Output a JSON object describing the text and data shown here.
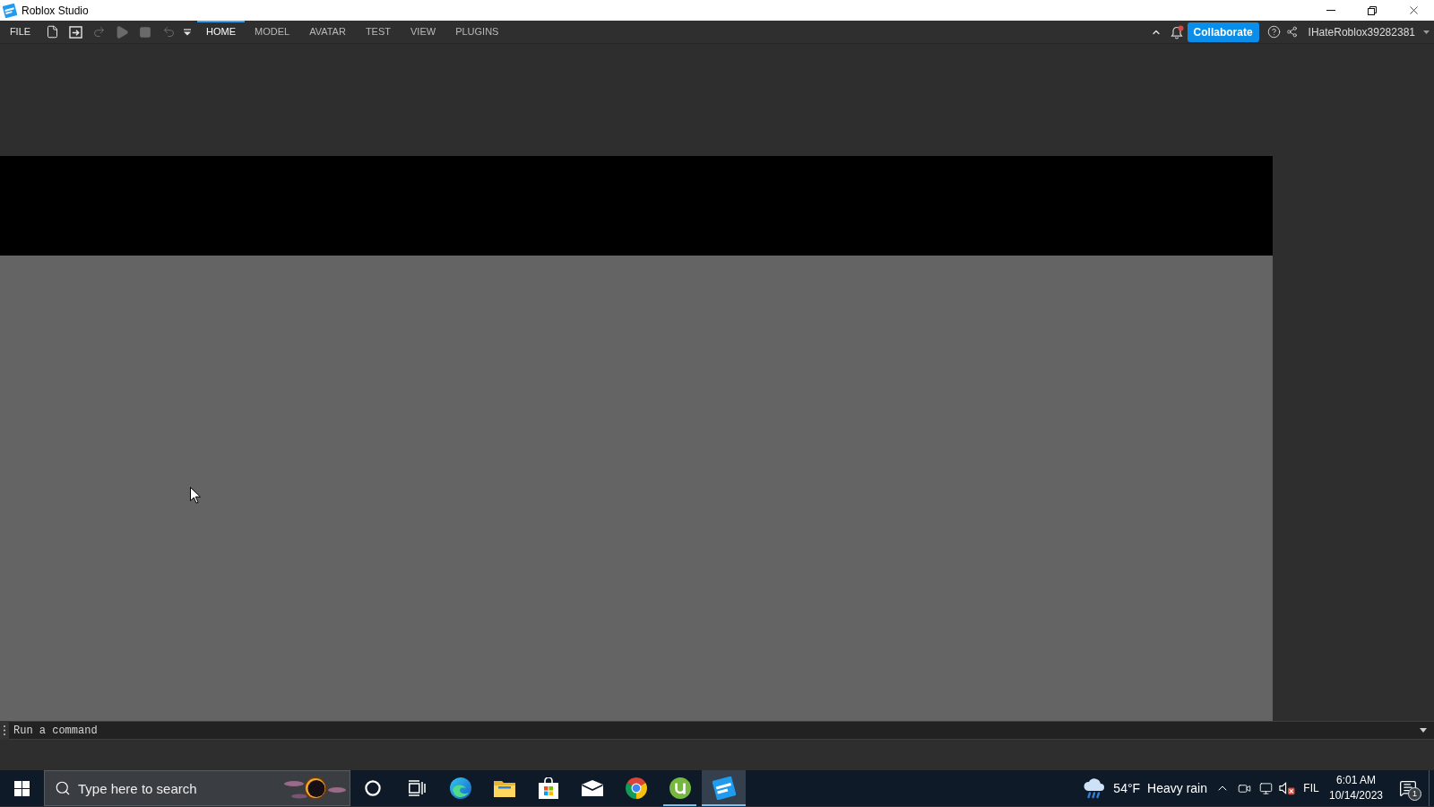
{
  "window": {
    "title": "Roblox Studio"
  },
  "ribbon": {
    "file_menu": "FILE",
    "quick_access": [
      {
        "kind": "new",
        "disabled": false
      },
      {
        "kind": "import",
        "disabled": false
      },
      {
        "kind": "redo",
        "disabled": true
      },
      {
        "kind": "play",
        "disabled": true
      },
      {
        "kind": "stop",
        "disabled": true
      },
      {
        "kind": "undo",
        "disabled": true
      },
      {
        "kind": "customize",
        "disabled": false
      }
    ],
    "tabs": [
      {
        "label": "HOME",
        "selected": true
      },
      {
        "label": "MODEL",
        "selected": false
      },
      {
        "label": "AVATAR",
        "selected": false
      },
      {
        "label": "TEST",
        "selected": false
      },
      {
        "label": "VIEW",
        "selected": false
      },
      {
        "label": "PLUGINS",
        "selected": false
      }
    ],
    "alerts_unread": true,
    "collaborate_button": "Collaborate",
    "username": "IHateRoblox39282381"
  },
  "command_bar": {
    "placeholder": "Run a command"
  },
  "taskbar": {
    "search": {
      "placeholder": "Type here to search"
    },
    "apps": [
      {
        "kind": "cortana",
        "running": false,
        "selected": false
      },
      {
        "kind": "task_view",
        "running": false,
        "selected": false
      },
      {
        "kind": "edge",
        "running": false,
        "selected": false
      },
      {
        "kind": "explorer",
        "running": false,
        "selected": false
      },
      {
        "kind": "store",
        "running": false,
        "selected": false
      },
      {
        "kind": "mail",
        "running": false,
        "selected": false
      },
      {
        "kind": "chrome",
        "running": false,
        "selected": false
      },
      {
        "kind": "utorrent",
        "running": true,
        "selected": false
      },
      {
        "kind": "roblox",
        "running": true,
        "selected": true
      }
    ],
    "weather": {
      "temperature": "54°F",
      "condition": "Heavy rain"
    },
    "volume_muted": true,
    "language": "FIL",
    "clock": {
      "time": "6:01 AM",
      "date": "10/14/2023"
    },
    "notification_count": "1"
  }
}
